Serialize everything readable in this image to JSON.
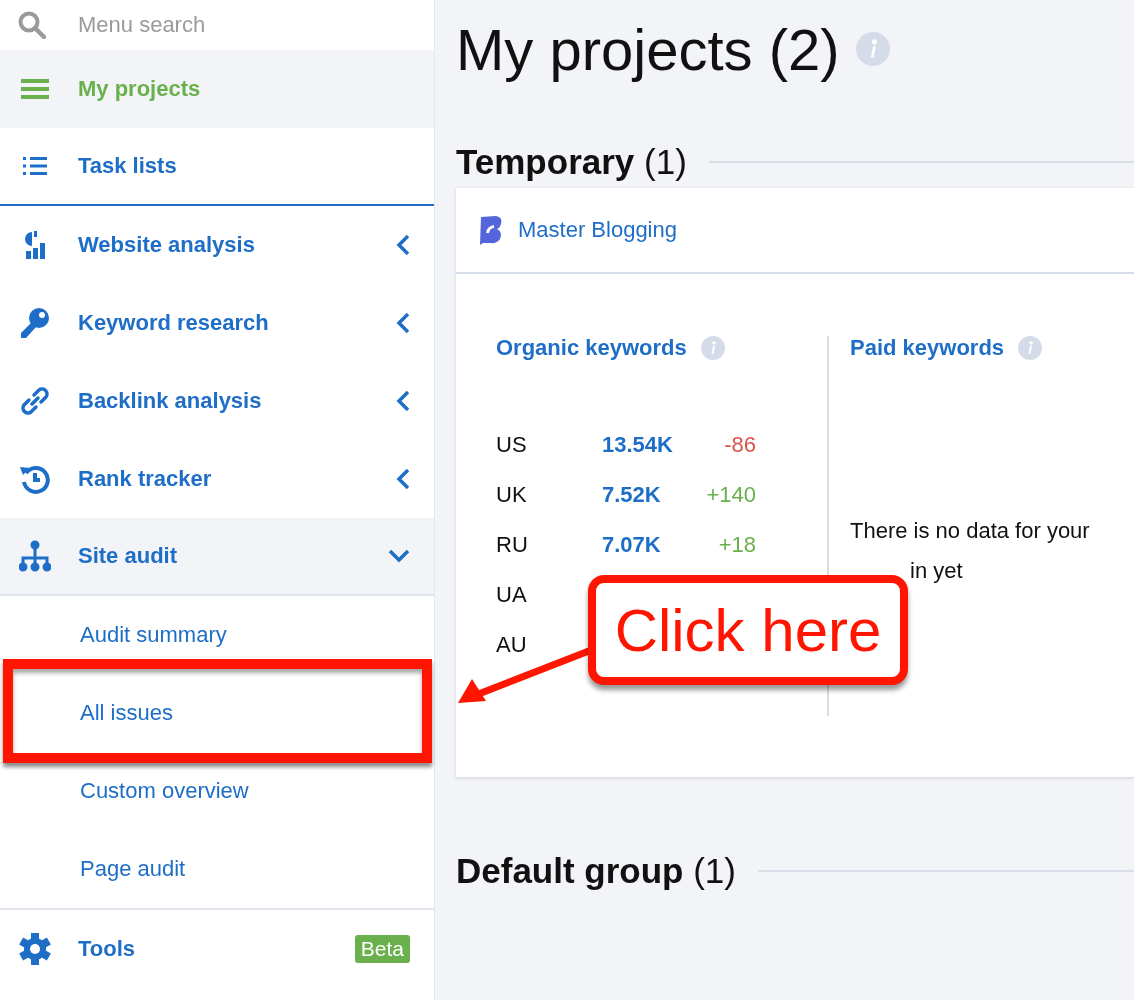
{
  "sidebar": {
    "search": {
      "placeholder": "Menu search"
    },
    "items": [
      {
        "label": "My projects",
        "selected": true
      },
      {
        "label": "Task lists",
        "selected": false
      },
      {
        "label": "Website analysis",
        "selected": false,
        "expanded": false
      },
      {
        "label": "Keyword research",
        "selected": false,
        "expanded": false
      },
      {
        "label": "Backlink analysis",
        "selected": false,
        "expanded": false
      },
      {
        "label": "Rank tracker",
        "selected": false,
        "expanded": false
      },
      {
        "label": "Site audit",
        "selected": false,
        "expanded": true,
        "children": [
          {
            "label": "Audit summary",
            "selected": false,
            "highlighted": false
          },
          {
            "label": "All issues",
            "selected": false,
            "highlighted": true
          },
          {
            "label": "Custom overview",
            "selected": false,
            "highlighted": false
          },
          {
            "label": "Page audit",
            "selected": false,
            "highlighted": false
          }
        ]
      },
      {
        "label": "Tools",
        "selected": false,
        "badge": "Beta"
      }
    ]
  },
  "main": {
    "title": "My projects (2)",
    "groups": [
      {
        "name": "Temporary",
        "count": "(1)",
        "projects": [
          {
            "name": "Master Blogging",
            "organic": {
              "title": "Organic keywords",
              "rows": [
                {
                  "country": "US",
                  "value": "13.54K",
                  "change": "-86",
                  "color": "#d9534f"
                },
                {
                  "country": "UK",
                  "value": "7.52K",
                  "change": "+140",
                  "color": "#6ab04c"
                },
                {
                  "country": "RU",
                  "value": "7.07K",
                  "change": "+18",
                  "color": "#6ab04c"
                },
                {
                  "country": "UA"
                },
                {
                  "country": "AU"
                }
              ]
            },
            "paid": {
              "title": "Paid keywords",
              "message": "There is no data for your",
              "message_rest": "in yet"
            }
          }
        ]
      },
      {
        "name": "Default group",
        "count": "(1)"
      }
    ]
  },
  "annotation": {
    "callout": "Click here"
  }
}
